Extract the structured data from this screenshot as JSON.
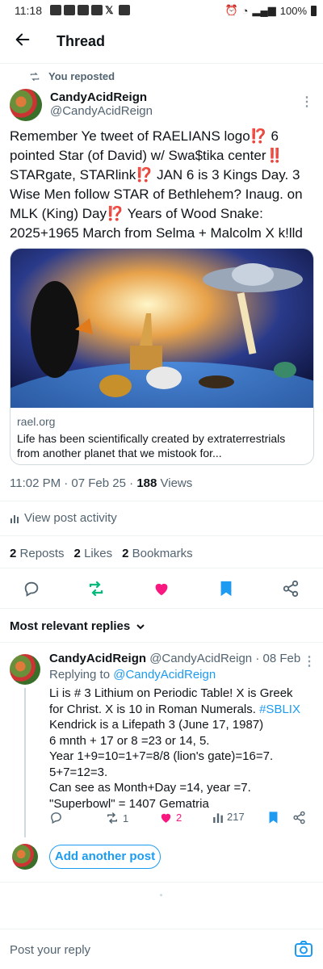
{
  "statusbar": {
    "time": "11:18",
    "battery": "100%"
  },
  "header": {
    "title": "Thread"
  },
  "repost": {
    "label": "You reposted"
  },
  "tweet": {
    "display_name": "CandyAcidReign",
    "handle": "@CandyAcidReign",
    "text": "Remember Ye tweet of RAELIANS logo⁉️ 6 pointed Star (of David) w/ Swa$tika center‼️ STARgate, STARlink⁉️ JAN 6 is 3 Kings Day. 3 Wise Men follow STAR of Bethlehem? Inaug. on MLK (King) Day⁉️ Years of Wood Snake: 2025+1965 March from Selma + Malcolm X k!lld",
    "card": {
      "domain": "rael.org",
      "description": "Life has been scientifically created by extraterrestrials from another planet that we mistook for..."
    },
    "timestamp": "11:02 PM · 07 Feb 25 · ",
    "views_count": "188",
    "views_label": " Views",
    "view_activity": "View post activity",
    "reposts_count": "2",
    "reposts_label": "Reposts",
    "likes_count": "2",
    "likes_label": "Likes",
    "bookmarks_count": "2",
    "bookmarks_label": "Bookmarks"
  },
  "replies_filter": "Most relevant replies",
  "reply": {
    "display_name": "CandyAcidReign",
    "handle": "@CandyAcidReign · 08 Feb",
    "replying_prefix": "Replying to ",
    "replying_to": "@CandyAcidReign",
    "text_before_tag": "Li is # 3 Lithium on Periodic Table! X is Greek for Christ. X is 10 in Roman Numerals. ",
    "hashtag": "#SBLIX",
    "text_after_tag": "\nKendrick is a Lifepath 3 (June 17, 1987)\n6 mnth + 17 or 8 =23 or 14, 5.\nYear 1+9=10=1+7=8/8 (lion's gate)=16=7.\n5+7=12=3.\nCan see as Month+Day =14, year =7. \"Superbowl\" = 1407 Gematria",
    "reposts": "1",
    "likes": "2",
    "views": "217"
  },
  "add_post_label": "Add another post",
  "composer": {
    "placeholder": "Post your reply"
  },
  "colors": {
    "accent": "#1d9bf0",
    "like": "#f91880",
    "repost_active": "#00ba7c"
  }
}
